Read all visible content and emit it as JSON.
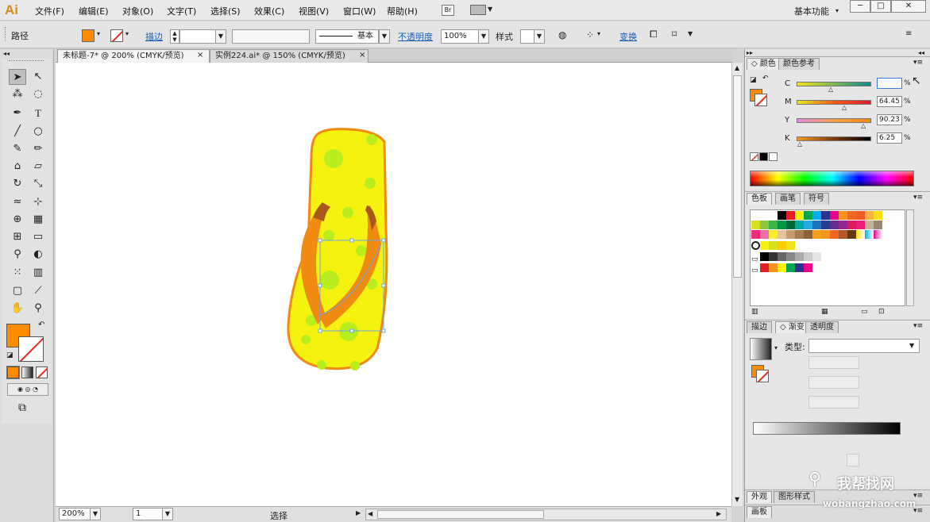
{
  "app": {
    "logo": "Ai"
  },
  "menus": [
    "文件(F)",
    "编辑(E)",
    "对象(O)",
    "文字(T)",
    "选择(S)",
    "效果(C)",
    "视图(V)",
    "窗口(W)",
    "帮助(H)"
  ],
  "bridge": "Br",
  "workspace": "基本功能",
  "control": {
    "object_type": "路径",
    "stroke_label": "描边",
    "stroke_style": "基本",
    "opacity_label": "不透明度",
    "opacity_value": "100%",
    "style_label": "样式",
    "transform_label": "变换",
    "fill_color": "#ff8c00"
  },
  "tabs": [
    {
      "label": "未标题-7* @ 200% (CMYK/预览)",
      "close": "×"
    },
    {
      "label": "实例224.ai* @ 150% (CMYK/预览)",
      "close": "×"
    }
  ],
  "status": {
    "zoom": "200%",
    "artboard": "1",
    "tool": "选择"
  },
  "color_panel": {
    "tabs": [
      "颜色",
      "颜色参考"
    ],
    "channels": [
      {
        "label": "C",
        "value": ""
      },
      {
        "label": "M",
        "value": "64.45"
      },
      {
        "label": "Y",
        "value": "90.23"
      },
      {
        "label": "K",
        "value": "6.25"
      }
    ],
    "percent": "%"
  },
  "swatches_panel": {
    "tabs": [
      "色板",
      "画笔",
      "符号"
    ]
  },
  "gradient_panel": {
    "tabs": [
      "描边",
      "渐变",
      "透明度"
    ],
    "type_label": "类型:"
  },
  "bottom_panels": {
    "appearance": "外观",
    "graphic_styles": "图形样式",
    "artboards": "画板"
  },
  "colors": {
    "accent_orange": "#ff8c00",
    "sole_yellow": "#f5f20f",
    "dots": "#b8ee1e",
    "strap_orange": "#f08a10"
  },
  "watermark": {
    "name": "我帮找网",
    "url": "wobangzhao.com"
  }
}
